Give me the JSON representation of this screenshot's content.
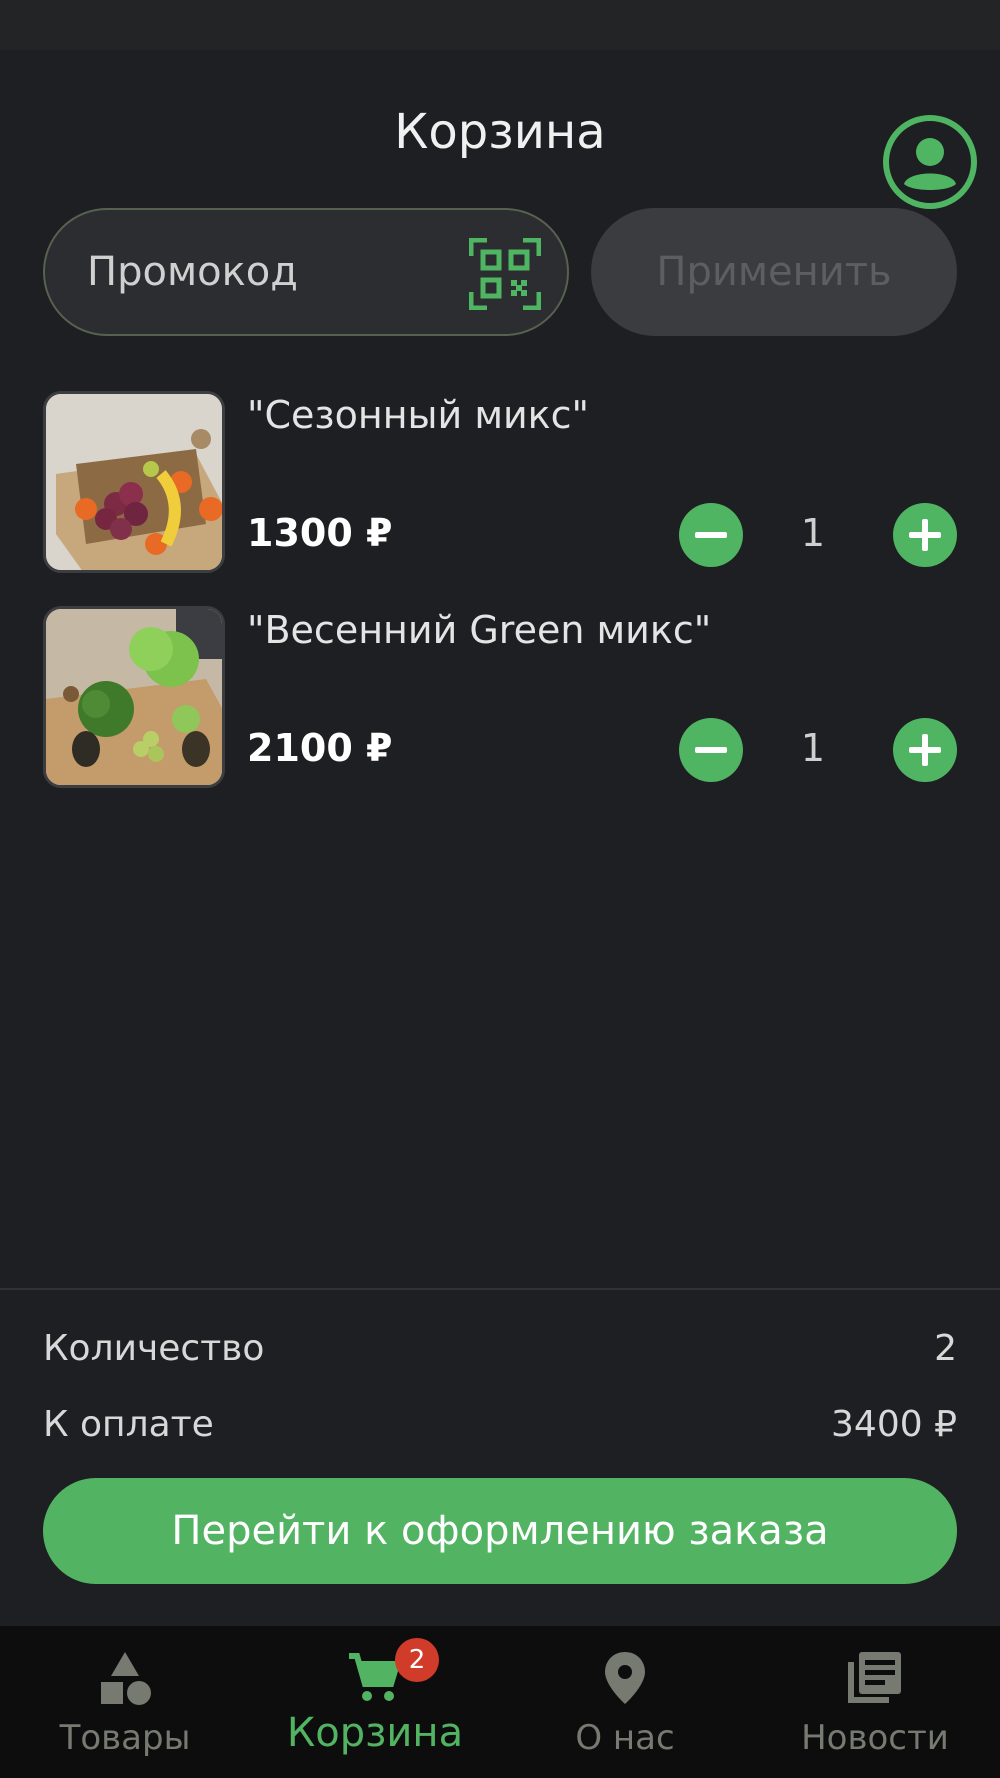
{
  "header": {
    "title": "Корзина",
    "profile_icon": "account-circle-icon"
  },
  "promo": {
    "placeholder": "Промокод",
    "scan_icon": "qr-code-icon",
    "apply_label": "Применить"
  },
  "cart_items": [
    {
      "name": " \"Сезонный микс\"",
      "price": "1300 ₽",
      "quantity": "1"
    },
    {
      "name": "\"Весенний Green микс\"",
      "price": "2100 ₽",
      "quantity": "1"
    }
  ],
  "summary": {
    "count_label": "Количество",
    "count_value": "2",
    "total_label": "К оплате",
    "total_value": "3400 ₽",
    "checkout_label": "Перейти к оформлению заказа"
  },
  "nav": {
    "items": [
      {
        "label": "Товары",
        "icon": "shapes-icon"
      },
      {
        "label": "Корзина",
        "icon": "cart-icon",
        "badge": "2"
      },
      {
        "label": "О нас",
        "icon": "location-pin-icon"
      },
      {
        "label": "Новости",
        "icon": "news-icon"
      }
    ]
  },
  "colors": {
    "accent": "#52b462",
    "background": "#1e1f22",
    "badge": "#d13b2a"
  }
}
